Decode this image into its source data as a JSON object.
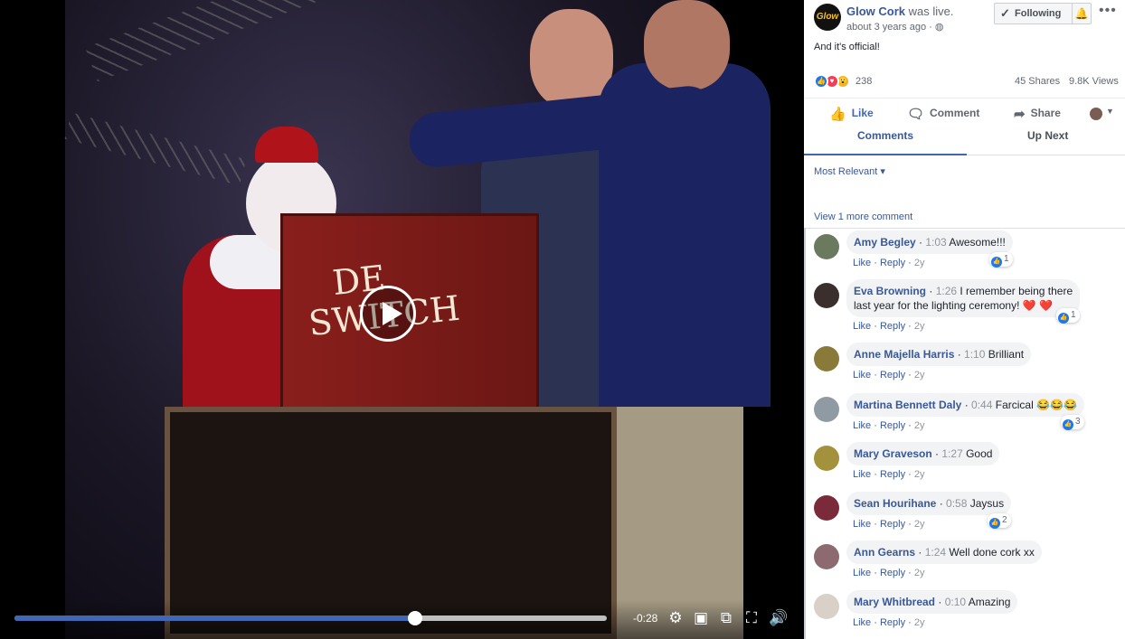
{
  "video": {
    "box_text": "DE SWITCH",
    "time_remaining": "-0:28",
    "progress": 0.677
  },
  "post": {
    "page_name": "Glow Cork",
    "page_logo_text": "Glow",
    "live_text": "was live.",
    "time": "about 3 years ago",
    "follow_label": "Following",
    "caption": "And it's official!",
    "reaction_count": "238",
    "shares": "45 Shares",
    "views": "9.8K Views",
    "actions": {
      "like": "Like",
      "comment": "Comment",
      "share": "Share"
    },
    "tabs": {
      "comments": "Comments",
      "up_next": "Up Next"
    },
    "sort": "Most Relevant",
    "view_more": "View 1 more comment"
  },
  "comments": [
    {
      "name": "Amy Begley",
      "ts": "1:03",
      "text": "Awesome!!!",
      "likes": "1",
      "avatar": "#6b7a5e"
    },
    {
      "name": "Eva Browning",
      "ts": "1:26",
      "text": "I remember being there",
      "text2": "last year for the lighting ceremony! ❤️ ❤️",
      "likes": "1",
      "avatar": "#3b2f2d"
    },
    {
      "name": "Anne Majella Harris",
      "ts": "1:10",
      "text": "Brilliant",
      "likes": "",
      "avatar": "#8a7a3a"
    },
    {
      "name": "Martina Bennett Daly",
      "ts": "0:44",
      "text": "Farcical 😂😂😂",
      "likes": "3",
      "avatar": "#8f9aa3"
    },
    {
      "name": "Mary Graveson",
      "ts": "1:27",
      "text": "Good",
      "likes": "",
      "avatar": "#a3913b"
    },
    {
      "name": "Sean Hourihane",
      "ts": "0:58",
      "text": "Jaysus",
      "likes": "2",
      "avatar": "#7a2a3a"
    },
    {
      "name": "Ann Gearns",
      "ts": "1:24",
      "text": "Well done cork xx",
      "likes": "",
      "avatar": "#8c6a70"
    },
    {
      "name": "Mary Whitbread",
      "ts": "0:10",
      "text": "Amazing",
      "likes": "",
      "avatar": "#d9d0c8"
    }
  ],
  "comment_meta": {
    "like": "Like",
    "reply": "Reply",
    "age": "2y"
  }
}
